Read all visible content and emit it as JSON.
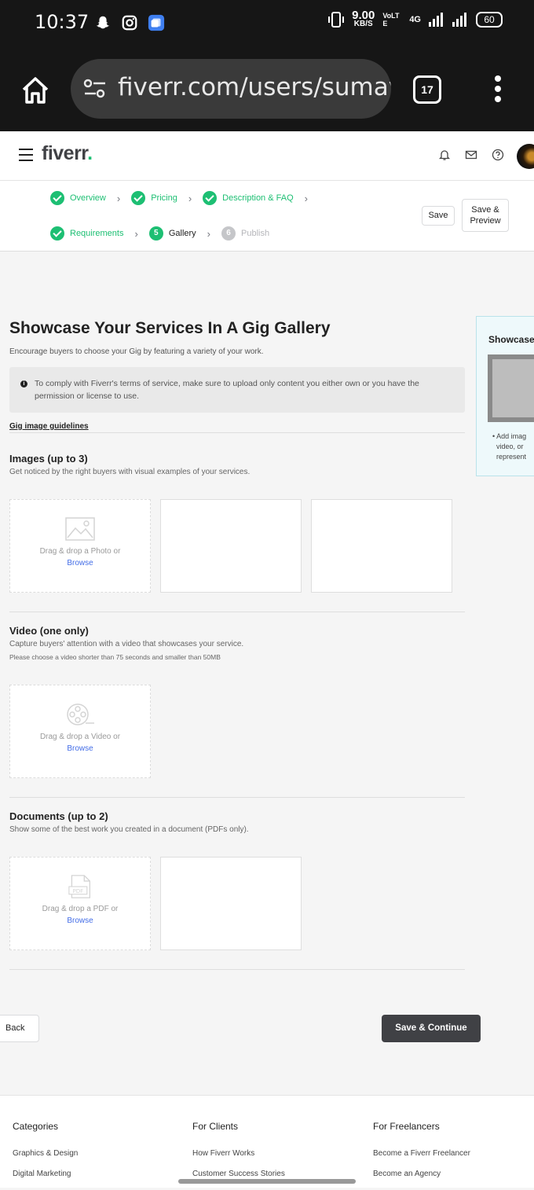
{
  "status_bar": {
    "time": "10:37",
    "net_speed": "9.00",
    "net_unit": "KB/S",
    "volte": "VoLTE",
    "net_type": "4G",
    "battery": "60"
  },
  "browser": {
    "url": "fiverr.com/users/sumay",
    "tab_count": "17"
  },
  "header": {
    "logo": "fiverr",
    "logo_dot": "."
  },
  "steps": {
    "row1": [
      {
        "label": "Overview"
      },
      {
        "label": "Pricing"
      },
      {
        "label": "Description & FAQ"
      }
    ],
    "row2": [
      {
        "label": "Requirements"
      },
      {
        "label": "Gallery",
        "number": "5"
      },
      {
        "label": "Publish",
        "number": "6"
      }
    ],
    "save_label": "Save",
    "save_preview_label": "Save & Preview"
  },
  "page": {
    "title": "Showcase Your Services In A Gig Gallery",
    "subtitle": "Encourage buyers to choose your Gig by featuring a variety of your work.",
    "notice": "To comply with Fiverr's terms of service, make sure to upload only content you either own or you have the permission or license to use.",
    "guidelines_link": "Gig image guidelines"
  },
  "images_section": {
    "title": "Images (up to 3)",
    "description": "Get noticed by the right buyers with visual examples of your services.",
    "drop_text": "Drag & drop a Photo or",
    "browse": "Browse"
  },
  "video_section": {
    "title": "Video (one only)",
    "description": "Capture buyers' attention with a video that showcases your service.",
    "note": "Please choose a video shorter than 75 seconds and smaller than 50MB",
    "drop_text": "Drag & drop a Video or",
    "browse": "Browse"
  },
  "documents_section": {
    "title": "Documents (up to 2)",
    "description": "Show some of the best work you created in a document (PDFs only).",
    "drop_text": "Drag & drop a PDF or",
    "browse": "Browse"
  },
  "side_card": {
    "title": "Showcase",
    "bullet_lines": [
      "Add imag",
      "video, or",
      "represent"
    ]
  },
  "actions": {
    "back": "Back",
    "save_continue": "Save & Continue"
  },
  "footer": {
    "categories": {
      "heading": "Categories",
      "links": [
        "Graphics & Design",
        "Digital Marketing"
      ]
    },
    "clients": {
      "heading": "For Clients",
      "links": [
        "How Fiverr Works",
        "Customer Success Stories"
      ]
    },
    "freelancers": {
      "heading": "For Freelancers",
      "links": [
        "Become a Fiverr Freelancer",
        "Become an Agency"
      ]
    }
  },
  "colors": {
    "brand_green": "#1dbf73",
    "dark_button": "#404145",
    "link_blue": "#446ee7"
  }
}
